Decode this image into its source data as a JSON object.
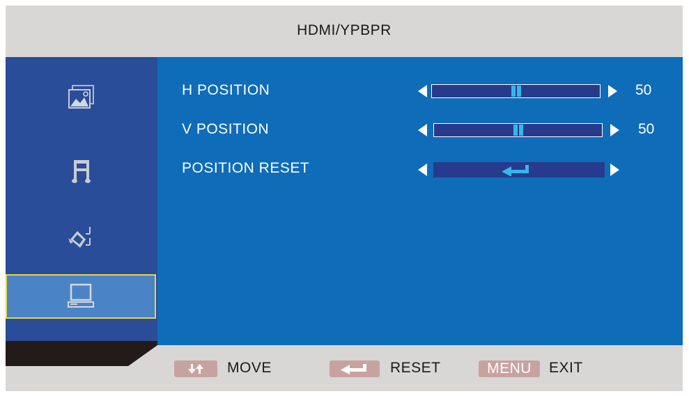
{
  "window": {
    "title": "HDMI/YPBPR"
  },
  "sidebar": {
    "items": [
      {
        "icon": "picture-icon",
        "selected": false
      },
      {
        "icon": "audio-icon",
        "selected": false
      },
      {
        "icon": "setup-icon",
        "selected": false
      },
      {
        "icon": "monitor-icon",
        "selected": true
      }
    ]
  },
  "settings": {
    "h_position": {
      "label": "H POSITION",
      "value": "50",
      "fraction": 0.5
    },
    "v_position": {
      "label": "V POSITION",
      "value": "50",
      "fraction": 0.5
    },
    "position_reset": {
      "label": "POSITION RESET",
      "icon": "enter-icon"
    }
  },
  "footer": {
    "move": {
      "label": "MOVE",
      "icon": "up-down-arrows-icon"
    },
    "reset": {
      "label": "RESET",
      "icon": "enter-icon"
    },
    "exit": {
      "badge": "MENU",
      "label": "EXIT"
    }
  },
  "colors": {
    "panel": "#0f6cb8",
    "sidebar": "#2a4d99",
    "selection": "#4a84c6",
    "selection_border": "#e8d64a",
    "slider_thumb": "#35b7ea",
    "key_badge": "#c7a3a0"
  }
}
